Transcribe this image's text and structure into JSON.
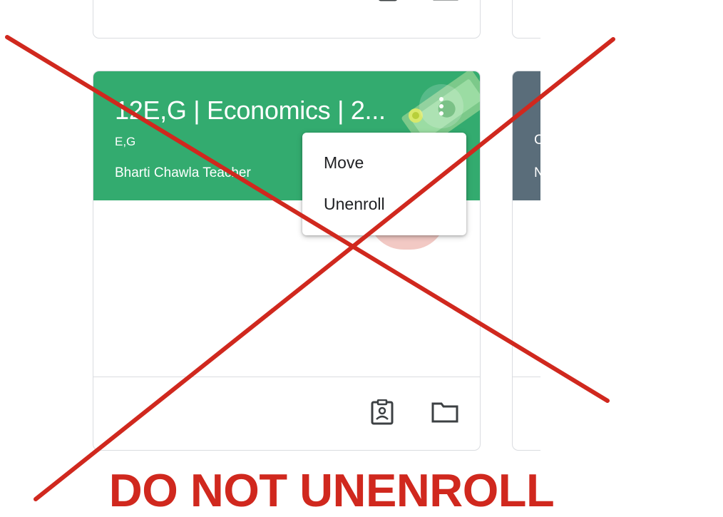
{
  "class_card": {
    "title": "12E,G | Economics | 2...",
    "section": "E,G",
    "teacher": "Bharti Chawla Teacher",
    "banner_color": "#33ab6f",
    "icons": [
      "more-vert-icon",
      "assignment-ind-icon",
      "folder-icon"
    ]
  },
  "neighbor_card": {
    "banner_color": "#5a6d7a",
    "line1_partial": "C",
    "line2_partial": "N"
  },
  "context_menu": {
    "items": [
      "Move",
      "Unenroll"
    ]
  },
  "overlay": {
    "warning": "DO NOT UNENROLL",
    "color": "#d0281e"
  }
}
